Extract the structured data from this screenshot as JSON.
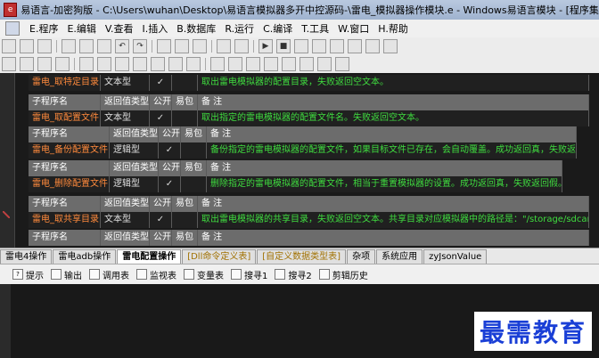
{
  "window": {
    "title": "易语言-加密狗版 - C:\\Users\\wuhan\\Desktop\\易语言模拟器多开中控源码-\\雷电_模拟器操作模块.e - Windows易语言模块 - [程序集: 雷电..."
  },
  "menu": [
    "E.程序",
    "E.编辑",
    "V.查看",
    "I.插入",
    "B.数据库",
    "R.运行",
    "C.编译",
    "T.工具",
    "W.窗口",
    "H.帮助"
  ],
  "headers": {
    "name": "子程序名",
    "rettype": "返回值类型",
    "public": "公开",
    "easy": "易包",
    "note": "备 注"
  },
  "check": "✓",
  "rows": [
    {
      "name": "雷电_取特定目录",
      "type": "文本型",
      "note": "取出雷电模拟器的配置目录，失败返回空文本。"
    },
    {
      "name": "雷电_取配置文件",
      "type": "文本型",
      "note": "取出指定的雷电模拟器的配置文件名。失败返回空文本。"
    },
    {
      "name": "雷电_备份配置文件",
      "type": "逻辑型",
      "note": "备份指定的雷电模拟器的配置文件，如果目标文件已存在，会自动覆盖。成功返回真，失败返回假。"
    },
    {
      "name": "雷电_删除配置文件",
      "type": "逻辑型",
      "note": "删除指定的雷电模拟器的配置文件，相当于重置模拟器的设置。成功返回真，失败返回假。"
    },
    {
      "name": "雷电_取共享目录",
      "type": "文本型",
      "note": "取出雷电模拟器的共享目录，失败返回空文本。共享目录对应模拟器中的路径是：\"/storage/sdcard0/Pic"
    }
  ],
  "tabs": [
    "雷电4操作",
    "雷电adb操作",
    "雷电配置操作",
    "[Dll命令定义表]",
    "[自定义数据类型表]",
    "杂项",
    "系统应用",
    "zyJsonValue"
  ],
  "panel": [
    "提示",
    "输出",
    "调用表",
    "监视表",
    "变量表",
    "搜寻1",
    "搜寻2",
    "剪辑历史"
  ],
  "watermark": "最需教育"
}
